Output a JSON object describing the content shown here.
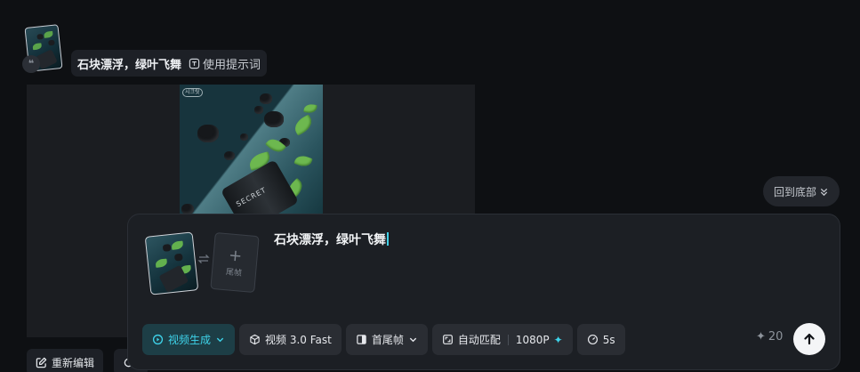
{
  "history": {
    "prompt_text": "石块漂浮，绿叶飞舞",
    "use_prompt_label": "使用提示词",
    "preview_tag": "시크릿",
    "jar_label": "SECRET",
    "actions": [
      {
        "label": "重新编辑",
        "icon": "edit-icon"
      },
      {
        "label": "",
        "icon": "refresh-icon"
      }
    ]
  },
  "back_to_bottom_label": "回到底部",
  "composer": {
    "prompt_value": "石块漂浮，绿叶飞舞",
    "last_frame_label": "尾帧",
    "toolbar": {
      "mode_label": "视频生成",
      "model_label": "视频 3.0 Fast",
      "frames_label": "首尾帧",
      "ratio_label": "自动匹配",
      "resolution_label": "1080P",
      "duration_label": "5s"
    },
    "credits": "20"
  },
  "colors": {
    "accent": "#3ed3ea",
    "background": "#0e1013",
    "panel": "#1c1f24"
  }
}
